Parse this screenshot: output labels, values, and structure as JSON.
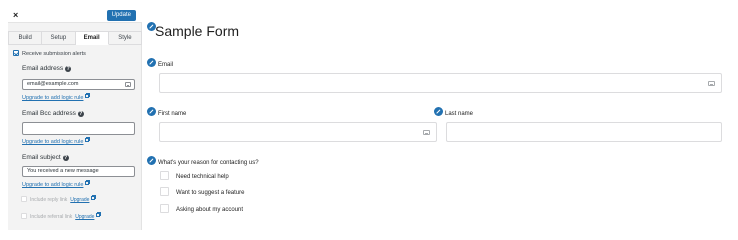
{
  "sidebar": {
    "close_label": "×",
    "update_label": "Update",
    "tabs": [
      "Build",
      "Setup",
      "Email",
      "Style"
    ],
    "active_tab": "Email",
    "receive_alerts_label": "Receive submission alerts",
    "email_address": {
      "label": "Email address",
      "value": "email@example.com",
      "logic_link": "Upgrade to add logic rule"
    },
    "email_bcc": {
      "label": "Email Bcc address",
      "value": "",
      "logic_link": "Upgrade to add logic rule"
    },
    "email_subject": {
      "label": "Email subject",
      "value": "You received a new message",
      "logic_link": "Upgrade to add logic rule"
    },
    "include_reply_link": {
      "label": "Include reply link",
      "upgrade": "Upgrade"
    },
    "include_referral_link": {
      "label": "Include referral link",
      "upgrade": "Upgrade"
    }
  },
  "form": {
    "title": "Sample Form",
    "email_label": "Email",
    "first_name_label": "First name",
    "last_name_label": "Last name",
    "reason_label": "What's your reason for contacting us?",
    "options": [
      "Need technical help",
      "Want to suggest a feature",
      "Asking about my account"
    ]
  },
  "colors": {
    "accent": "#2271b1",
    "sidebar_bg": "#f3f3f3",
    "border": "#dcdcde"
  }
}
